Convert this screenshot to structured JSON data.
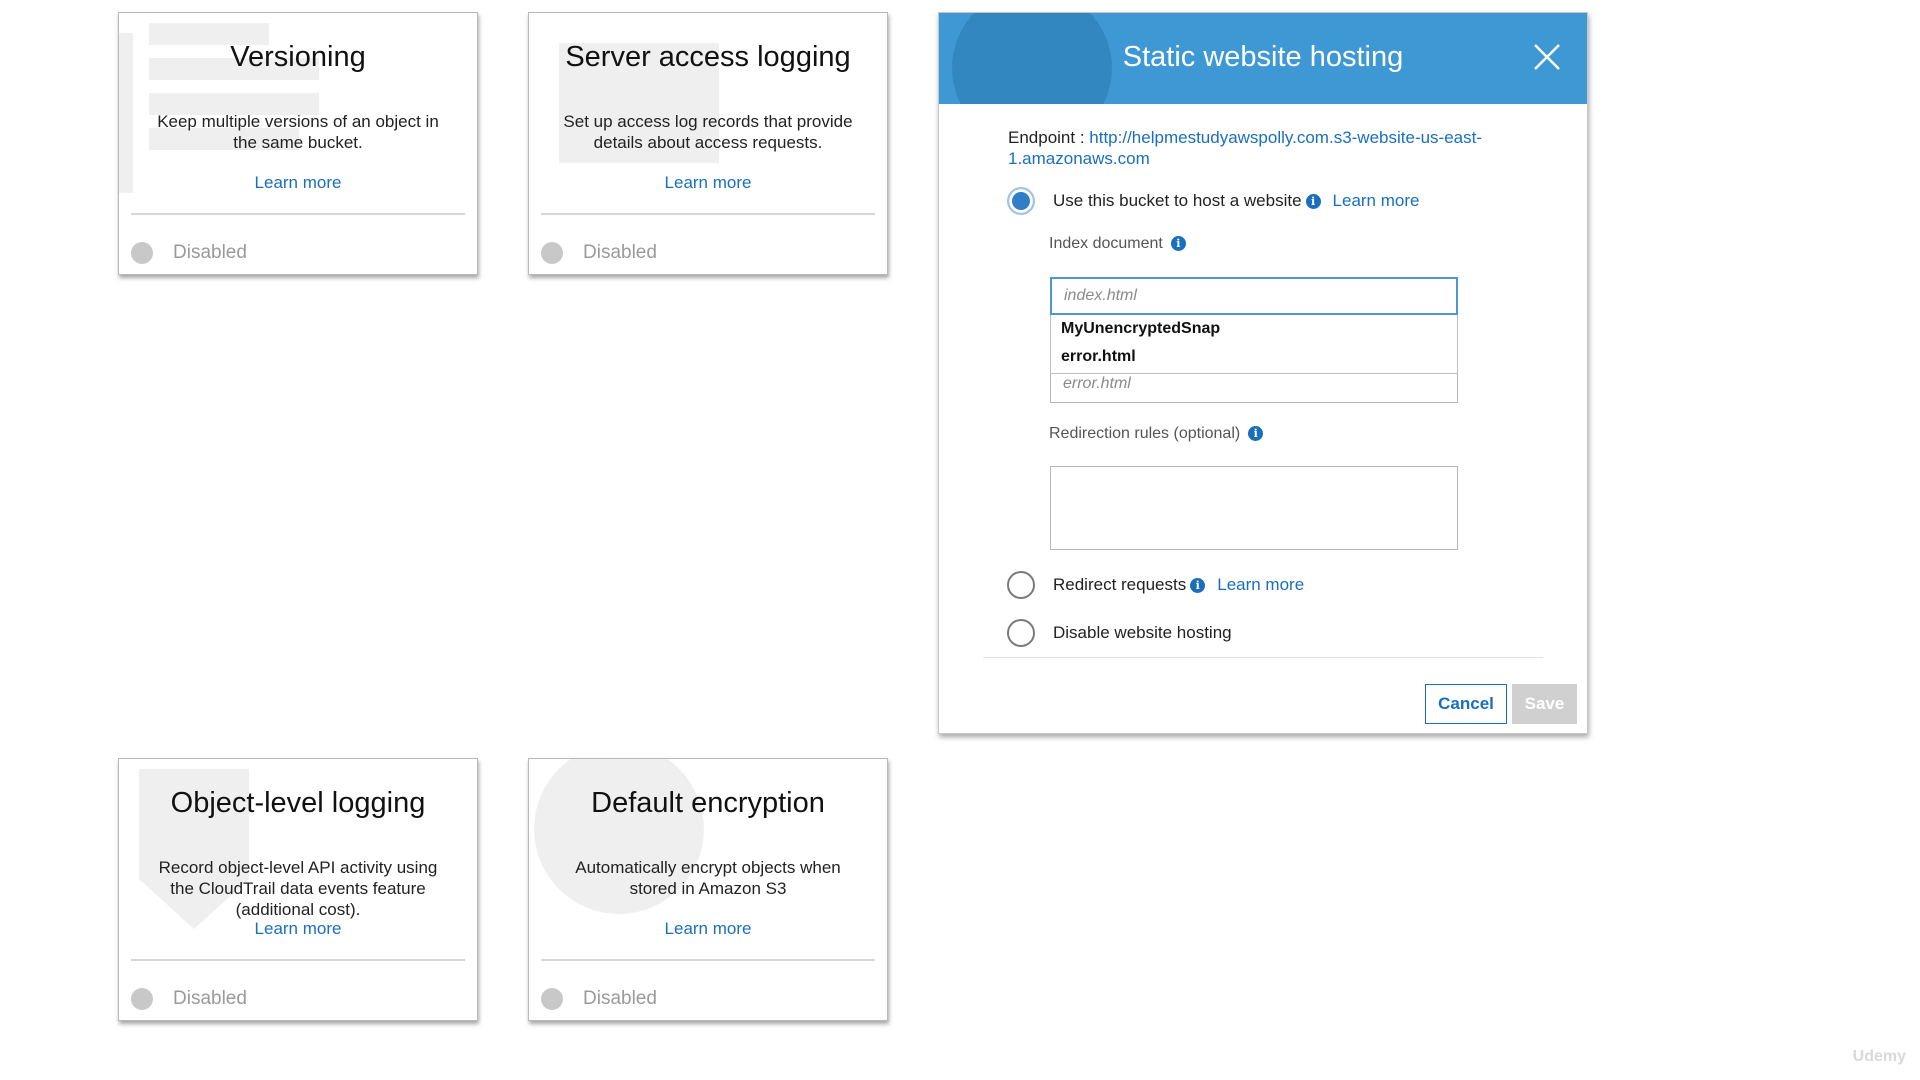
{
  "cards": {
    "versioning": {
      "title": "Versioning",
      "description": "Keep multiple versions of an object in the same bucket.",
      "learn_more": "Learn more",
      "status": "Disabled"
    },
    "server_access_logging": {
      "title": "Server access logging",
      "description": "Set up access log records that provide details about access requests.",
      "learn_more": "Learn more",
      "status": "Disabled"
    },
    "object_level_logging": {
      "title": "Object-level logging",
      "description": "Record object-level API activity using the CloudTrail data events feature (additional cost).",
      "learn_more": "Learn more",
      "status": "Disabled"
    },
    "default_encryption": {
      "title": "Default encryption",
      "description": "Automatically encrypt objects when stored in Amazon S3",
      "learn_more": "Learn more",
      "status": "Disabled"
    }
  },
  "modal": {
    "title": "Static website hosting",
    "endpoint_label": "Endpoint : ",
    "endpoint_url": "http://helpmestudyawspolly.com.s3-website-us-east-1.amazonaws.com",
    "options": {
      "host": {
        "label": "Use this bucket to host a website",
        "learn_more": "Learn more",
        "selected": true
      },
      "redirect": {
        "label": "Redirect requests",
        "learn_more": "Learn more",
        "selected": false
      },
      "disable": {
        "label": "Disable website hosting",
        "selected": false
      }
    },
    "index_document": {
      "label": "Index document",
      "placeholder": "index.html"
    },
    "autocomplete": [
      "MyUnencryptedSnap",
      "error.html"
    ],
    "error_document": {
      "placeholder": "error.html"
    },
    "redirection_rules": {
      "label": "Redirection rules (optional)",
      "value": ""
    },
    "buttons": {
      "cancel": "Cancel",
      "save": "Save"
    }
  },
  "watermark": "Udemy",
  "colors": {
    "header": "#3d98d4",
    "link": "#1a6fbd",
    "disabled_button": "#d0d0d0"
  },
  "icons": {
    "close": "close-icon",
    "info": "info-icon",
    "status": "status-dot-icon"
  }
}
